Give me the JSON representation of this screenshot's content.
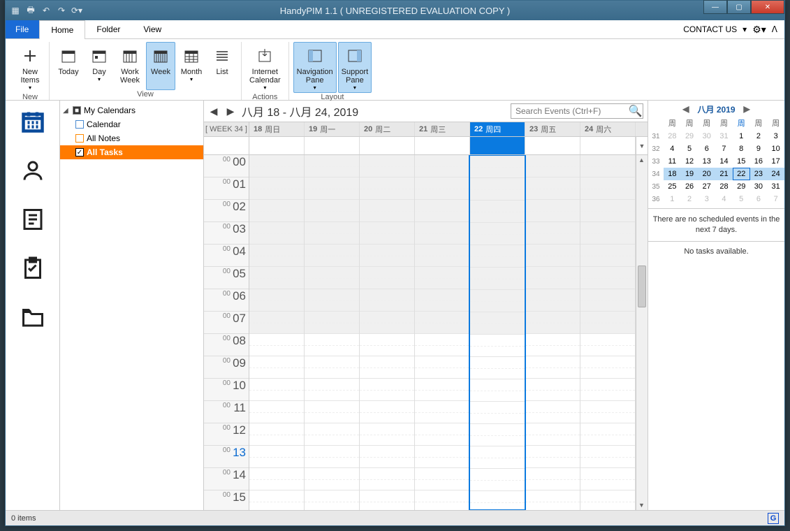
{
  "window": {
    "title": "HandyPIM 1.1 ( UNREGISTERED EVALUATION COPY )"
  },
  "menubar": {
    "file": "File",
    "home": "Home",
    "folder": "Folder",
    "view": "View",
    "contact": "CONTACT US"
  },
  "ribbon": {
    "new_items": "New\nItems",
    "new_group": "New",
    "today": "Today",
    "day": "Day",
    "workweek": "Work\nWeek",
    "week": "Week",
    "month": "Month",
    "list": "List",
    "view_group": "View",
    "internet_cal": "Internet\nCalendar",
    "actions_group": "Actions",
    "nav_pane": "Navigation\nPane",
    "support_pane": "Support\nPane",
    "layout_group": "Layout"
  },
  "tree": {
    "root": "My Calendars",
    "calendar": "Calendar",
    "allnotes": "All Notes",
    "alltasks": "All Tasks"
  },
  "cal": {
    "title": "八月 18 - 八月 24, 2019",
    "search_placeholder": "Search Events (Ctrl+F)",
    "weeknum": "[ WEEK 34 ]",
    "days": [
      {
        "n": "18",
        "w": "周日"
      },
      {
        "n": "19",
        "w": "周一"
      },
      {
        "n": "20",
        "w": "周二"
      },
      {
        "n": "21",
        "w": "周三"
      },
      {
        "n": "22",
        "w": "周四"
      },
      {
        "n": "23",
        "w": "周五"
      },
      {
        "n": "24",
        "w": "周六"
      }
    ],
    "hours": [
      "00",
      "01",
      "02",
      "03",
      "04",
      "05",
      "06",
      "07",
      "08",
      "09",
      "10",
      "11",
      "12",
      "13",
      "14",
      "15"
    ],
    "current_hour": "13",
    "selected_index": 4
  },
  "minical": {
    "title": "八月 2019",
    "dow": [
      "周",
      "周",
      "周",
      "周",
      "周",
      "周",
      "周"
    ],
    "weeks": [
      {
        "wn": "31",
        "d": [
          {
            "t": "28",
            "o": 1
          },
          {
            "t": "29",
            "o": 1
          },
          {
            "t": "30",
            "o": 1
          },
          {
            "t": "31",
            "o": 1
          },
          {
            "t": "1"
          },
          {
            "t": "2"
          },
          {
            "t": "3"
          }
        ]
      },
      {
        "wn": "32",
        "d": [
          {
            "t": "4"
          },
          {
            "t": "5"
          },
          {
            "t": "6"
          },
          {
            "t": "7"
          },
          {
            "t": "8"
          },
          {
            "t": "9"
          },
          {
            "t": "10"
          }
        ]
      },
      {
        "wn": "33",
        "d": [
          {
            "t": "11"
          },
          {
            "t": "12"
          },
          {
            "t": "13"
          },
          {
            "t": "14"
          },
          {
            "t": "15"
          },
          {
            "t": "16"
          },
          {
            "t": "17"
          }
        ]
      },
      {
        "wn": "34",
        "d": [
          {
            "t": "18",
            "hl": 1
          },
          {
            "t": "19",
            "hl": 1
          },
          {
            "t": "20",
            "hl": 1
          },
          {
            "t": "21",
            "hl": 1
          },
          {
            "t": "22",
            "hl": 1,
            "td": 1
          },
          {
            "t": "23",
            "hl": 1
          },
          {
            "t": "24",
            "hl": 1
          }
        ]
      },
      {
        "wn": "35",
        "d": [
          {
            "t": "25"
          },
          {
            "t": "26"
          },
          {
            "t": "27"
          },
          {
            "t": "28"
          },
          {
            "t": "29"
          },
          {
            "t": "30"
          },
          {
            "t": "31"
          }
        ]
      },
      {
        "wn": "36",
        "d": [
          {
            "t": "1",
            "o": 1
          },
          {
            "t": "2",
            "o": 1
          },
          {
            "t": "3",
            "o": 1
          },
          {
            "t": "4",
            "o": 1
          },
          {
            "t": "5",
            "o": 1
          },
          {
            "t": "6",
            "o": 1
          },
          {
            "t": "7",
            "o": 1
          }
        ]
      }
    ]
  },
  "right": {
    "events_msg": "There are no scheduled events in the next 7 days.",
    "tasks_msg": "No tasks available."
  },
  "status": {
    "items": "0 items",
    "g": "G"
  }
}
